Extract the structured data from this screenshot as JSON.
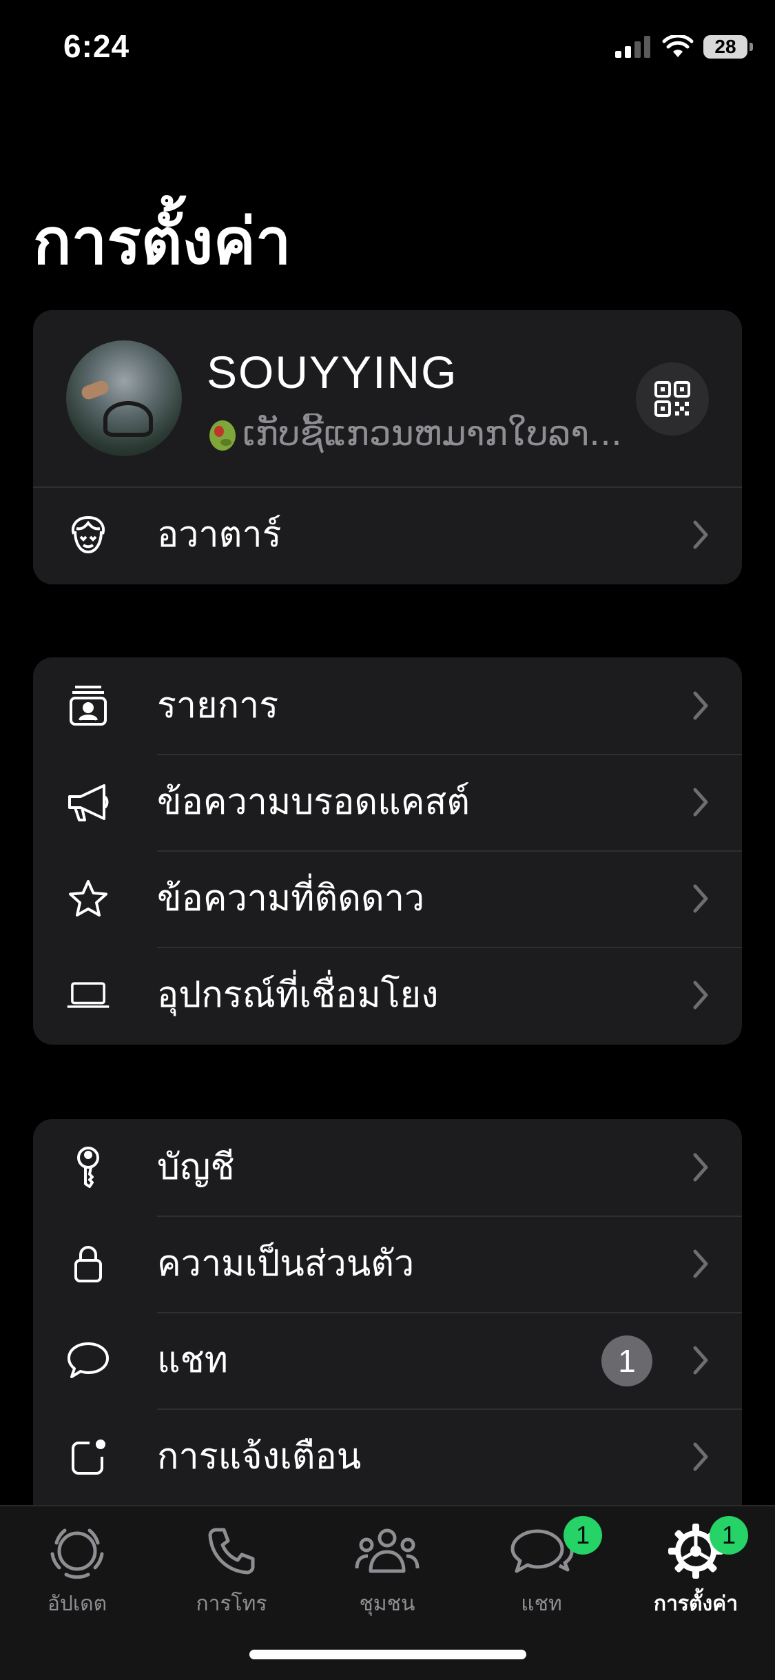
{
  "status_bar": {
    "time": "6:24",
    "battery": "28"
  },
  "page": {
    "title": "การตั้งค่า"
  },
  "profile": {
    "name": "SOUYYING",
    "status": "ເກັບຊີ້ແກວນຫມາກໃບລາ..."
  },
  "profile_card": {
    "items": [
      {
        "label": "อวาตาร์",
        "icon": "avatar-face-icon"
      }
    ]
  },
  "group1": {
    "items": [
      {
        "label": "รายการ",
        "icon": "contact-list-icon"
      },
      {
        "label": "ข้อความบรอดแคสต์",
        "icon": "megaphone-icon"
      },
      {
        "label": "ข้อความที่ติดดาว",
        "icon": "star-icon"
      },
      {
        "label": "อุปกรณ์ที่เชื่อมโยง",
        "icon": "laptop-icon"
      }
    ]
  },
  "group2": {
    "items": [
      {
        "label": "บัญชี",
        "icon": "key-icon"
      },
      {
        "label": "ความเป็นส่วนตัว",
        "icon": "lock-icon"
      },
      {
        "label": "แชท",
        "icon": "chat-bubble-icon",
        "badge": "1"
      },
      {
        "label": "การแจ้งเตือน",
        "icon": "notification-icon"
      }
    ]
  },
  "tab_bar": {
    "tabs": [
      {
        "label": "อัปเดต",
        "icon": "updates-icon"
      },
      {
        "label": "การโทร",
        "icon": "phone-icon"
      },
      {
        "label": "ชุมชน",
        "icon": "communities-icon"
      },
      {
        "label": "แชท",
        "icon": "chats-icon",
        "badge": "1"
      },
      {
        "label": "การตั้งค่า",
        "icon": "settings-gear-icon",
        "badge": "1",
        "active": true
      }
    ]
  },
  "colors": {
    "background": "#000000",
    "card": "#1c1c1e",
    "secondary_text": "#8e8e93",
    "badge_green": "#25d366",
    "badge_gray": "#6a6a6e"
  }
}
